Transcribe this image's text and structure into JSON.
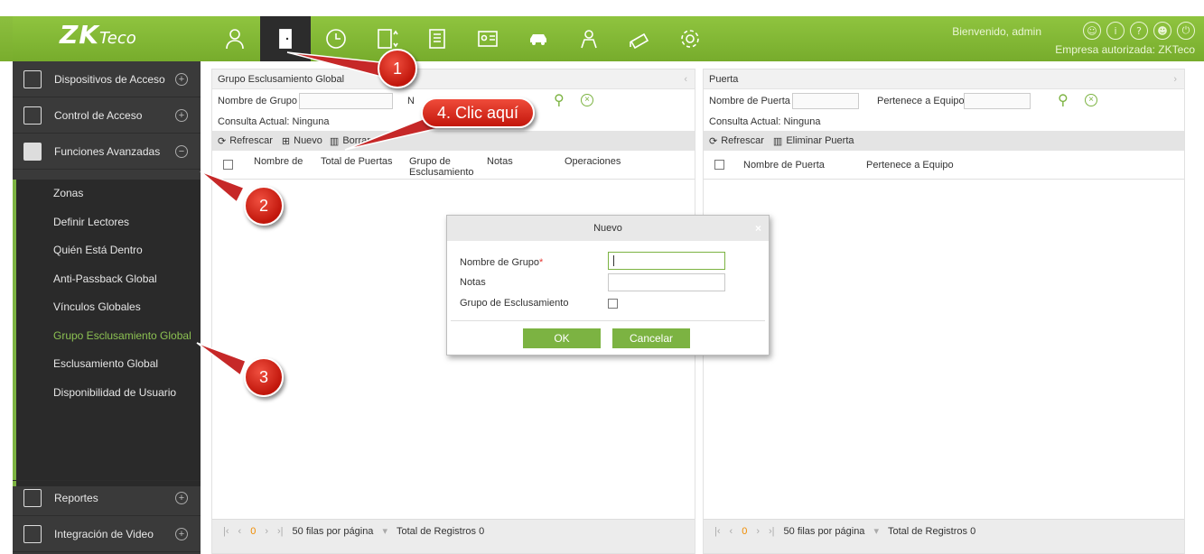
{
  "app": {
    "logo": "ZKTeco",
    "welcome": "Bienvenido, admin",
    "company": "Empresa autorizada: ZKTeco",
    "top_icons": [
      "person-icon",
      "door-icon",
      "clock-icon",
      "elevator-icon",
      "building-icon",
      "visitor-card-icon",
      "car-icon",
      "patrol-icon",
      "camera-icon",
      "gear-icon"
    ],
    "right_icons": [
      "user-icon",
      "info-icon",
      "help-icon",
      "account-icon",
      "power-icon"
    ]
  },
  "sidebar": {
    "main": [
      {
        "label": "Dispositivos de Acceso",
        "toggle": "+"
      },
      {
        "label": "Control de Acceso",
        "toggle": "+"
      },
      {
        "label": "Funciones Avanzadas",
        "toggle": "−"
      }
    ],
    "sub_items": [
      {
        "label": "Zonas"
      },
      {
        "label": "Definir Lectores"
      },
      {
        "label": "Quién Está Dentro"
      },
      {
        "label": "Anti-Passback Global"
      },
      {
        "label": "Vínculos Globales"
      },
      {
        "label": "Grupo Esclusamiento Global"
      },
      {
        "label": "Esclusamiento Global"
      },
      {
        "label": "Disponibilidad de Usuario"
      }
    ],
    "bottom": [
      {
        "label": "Reportes",
        "toggle": "+"
      },
      {
        "label": "Integración de Video",
        "toggle": "+"
      }
    ]
  },
  "left_panel": {
    "title": "Grupo Esclusamiento Global",
    "filter_label": "Nombre de Grupo",
    "filter_label2": "N",
    "current_query": "Consulta Actual: Ninguna",
    "refresh": "Refrescar",
    "new": "Nuevo",
    "delete": "Borrar",
    "columns": [
      "Nombre de",
      "Total de Puertas",
      "Grupo de Esclusamiento",
      "Notas",
      "Operaciones"
    ],
    "rows_per_page": "50 filas por página",
    "total": "Total de Registros 0",
    "page": "0"
  },
  "right_panel": {
    "title": "Puerta",
    "filter_label": "Nombre de Puerta",
    "filter_label2": "Pertenece a Equipo",
    "current_query": "Consulta Actual: Ninguna",
    "refresh": "Refrescar",
    "delete_door": "Eliminar Puerta",
    "columns": [
      "Nombre de Puerta",
      "Pertenece a Equipo"
    ],
    "rows_per_page": "50 filas por página",
    "total": "Total de Registros 0",
    "page": "0"
  },
  "dialog": {
    "title": "Nuevo",
    "group_name_label": "Nombre de Grupo",
    "required_mark": "*",
    "notes_label": "Notas",
    "interlock_label": "Grupo de Esclusamiento",
    "ok": "OK",
    "cancel": "Cancelar"
  },
  "callouts": {
    "c1": "1",
    "c2": "2",
    "c3": "3",
    "c4": "4. Clic aquí"
  },
  "colors": {
    "accent": "#7cb342",
    "callout": "#d32f2f",
    "sidebar": "#3a3a3a"
  }
}
